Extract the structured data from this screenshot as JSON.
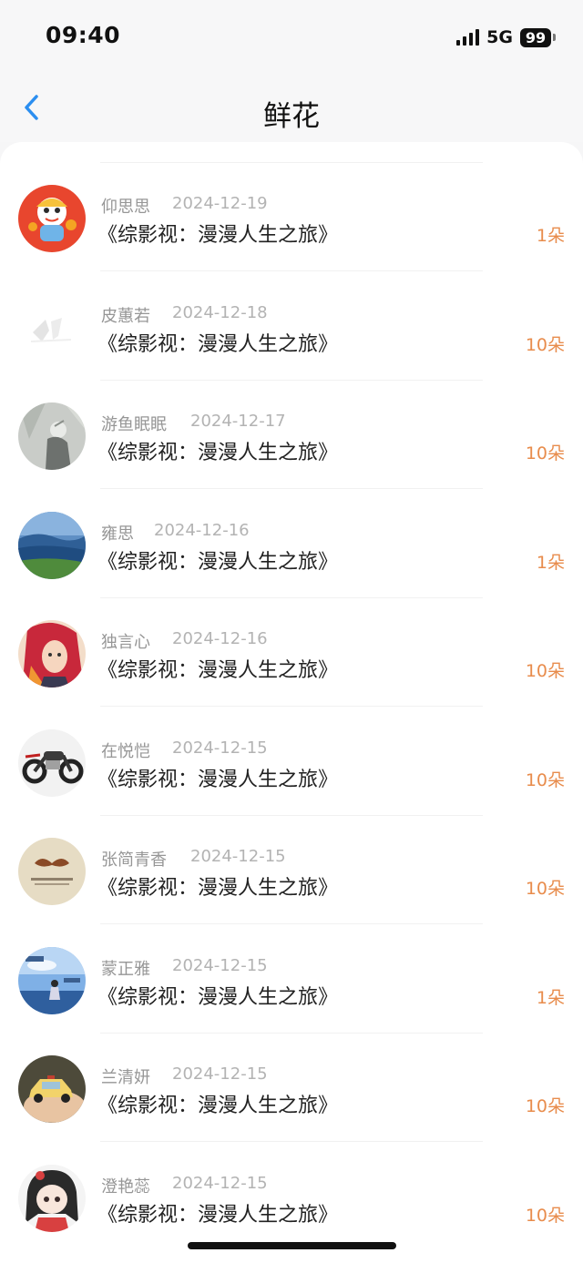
{
  "status": {
    "time": "09:40",
    "network": "5G",
    "battery": "99"
  },
  "nav": {
    "back_icon": "chevron-left-icon",
    "title": "鲜花",
    "accent_color": "#2b8ef0"
  },
  "colors": {
    "count_color": "#e88c4c",
    "name_color": "#969696",
    "date_color": "#b3b3b3"
  },
  "records": [
    {
      "name": "仰思思",
      "date": "2024-12-19",
      "title": "《综影视：漫漫人生之旅》",
      "count": "1朵",
      "avatar": "lion-dance-avatar"
    },
    {
      "name": "皮蕙若",
      "date": "2024-12-18",
      "title": "《综影视：漫漫人生之旅》",
      "count": "10朵",
      "avatar": "faded-sketch-avatar"
    },
    {
      "name": "游鱼眠眠",
      "date": "2024-12-17",
      "title": "《综影视：漫漫人生之旅》",
      "count": "10朵",
      "avatar": "gray-figure-avatar"
    },
    {
      "name": "雍思",
      "date": "2024-12-16",
      "title": "《综影视：漫漫人生之旅》",
      "count": "1朵",
      "avatar": "landscape-avatar"
    },
    {
      "name": "独言心",
      "date": "2024-12-16",
      "title": "《综影视：漫漫人生之旅》",
      "count": "10朵",
      "avatar": "anime-red-hair-avatar"
    },
    {
      "name": "在悦恺",
      "date": "2024-12-15",
      "title": "《综影视：漫漫人生之旅》",
      "count": "10朵",
      "avatar": "motorcycle-avatar"
    },
    {
      "name": "张简青香",
      "date": "2024-12-15",
      "title": "《综影视：漫漫人生之旅》",
      "count": "10朵",
      "avatar": "mustache-avatar"
    },
    {
      "name": "蒙正雅",
      "date": "2024-12-15",
      "title": "《综影视：漫漫人生之旅》",
      "count": "1朵",
      "avatar": "sky-girl-avatar"
    },
    {
      "name": "兰清妍",
      "date": "2024-12-15",
      "title": "《综影视：漫漫人生之旅》",
      "count": "10朵",
      "avatar": "toy-car-avatar"
    },
    {
      "name": "澄艳蕊",
      "date": "2024-12-15",
      "title": "《综影视：漫漫人生之旅》",
      "count": "10朵",
      "avatar": "anime-girl-avatar"
    }
  ]
}
